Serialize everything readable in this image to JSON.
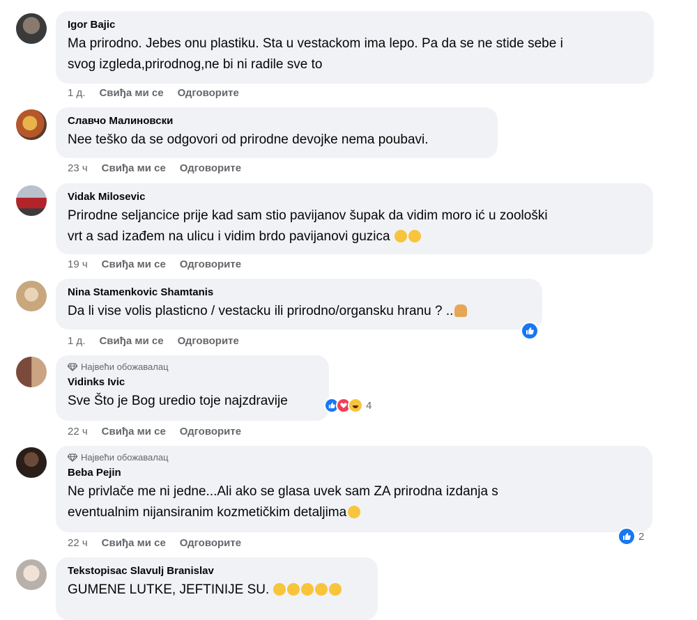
{
  "comments": [
    {
      "author": "Igor Bajic",
      "lines": [
        "Ma prirodno. Jebes onu plastiku. Sta u vestackom ima lepo. Pa da se ne stide sebe i",
        "svog izgleda,prirodnog,ne bi ni radile sve to"
      ],
      "time": "1 д.",
      "like": "Свиђа ми се",
      "reply": "Одговорите"
    },
    {
      "author": "Славчо Малиновски",
      "lines": [
        "Nee teško da se odgovori od prirodne devojke nema poubavi."
      ],
      "time": "23 ч",
      "like": "Свиђа ми се",
      "reply": "Одговорите"
    },
    {
      "author": "Vidak Milosevic",
      "lines": [
        "Prirodne seljancice prije kad sam stio pavijanov šupak da vidim moro ić u zoološki",
        "vrt a sad izađem na ulicu i vidim brdo pavijanovi guzica"
      ],
      "time": "19 ч",
      "like": "Свиђа ми се",
      "reply": "Одговорите"
    },
    {
      "author": "Nina Stamenkovic Shamtanis",
      "lines": [
        "Da li vise volis plasticno / vestacku ili prirodno/organsku hranu ? .."
      ],
      "time": "1 д.",
      "like": "Свиђа ми се",
      "reply": "Одговорите"
    },
    {
      "badge": "Највећи обожавалац",
      "author": "Vidinks Ivic",
      "lines": [
        "Sve Što je Bog uredio toje najzdravije"
      ],
      "reactions_count": "4",
      "time": "22 ч",
      "like": "Свиђа ми се",
      "reply": "Одговорите"
    },
    {
      "badge": "Највећи обожавалац",
      "author": "Beba Pejin",
      "lines": [
        "Ne privlače me ni jedne...Ali ako se glasa uvek sam ZA prirodna izdanja s",
        "eventualnim nijansiranim kozmetičkim detaljima"
      ],
      "reactions_count": "2",
      "time": "22 ч",
      "like": "Свиђа ми се",
      "reply": "Одговорите"
    },
    {
      "author": "Tekstopisac Slavulj Branislav",
      "lines": [
        "GUMENE LUTKE, JEFTINIJE SU."
      ]
    }
  ],
  "colors": {
    "bubble": "#f0f2f5",
    "muted": "#65676b",
    "like_blue": "#1877f2",
    "love_red": "#f33e58",
    "emoji_yellow": "#f7c43c"
  }
}
